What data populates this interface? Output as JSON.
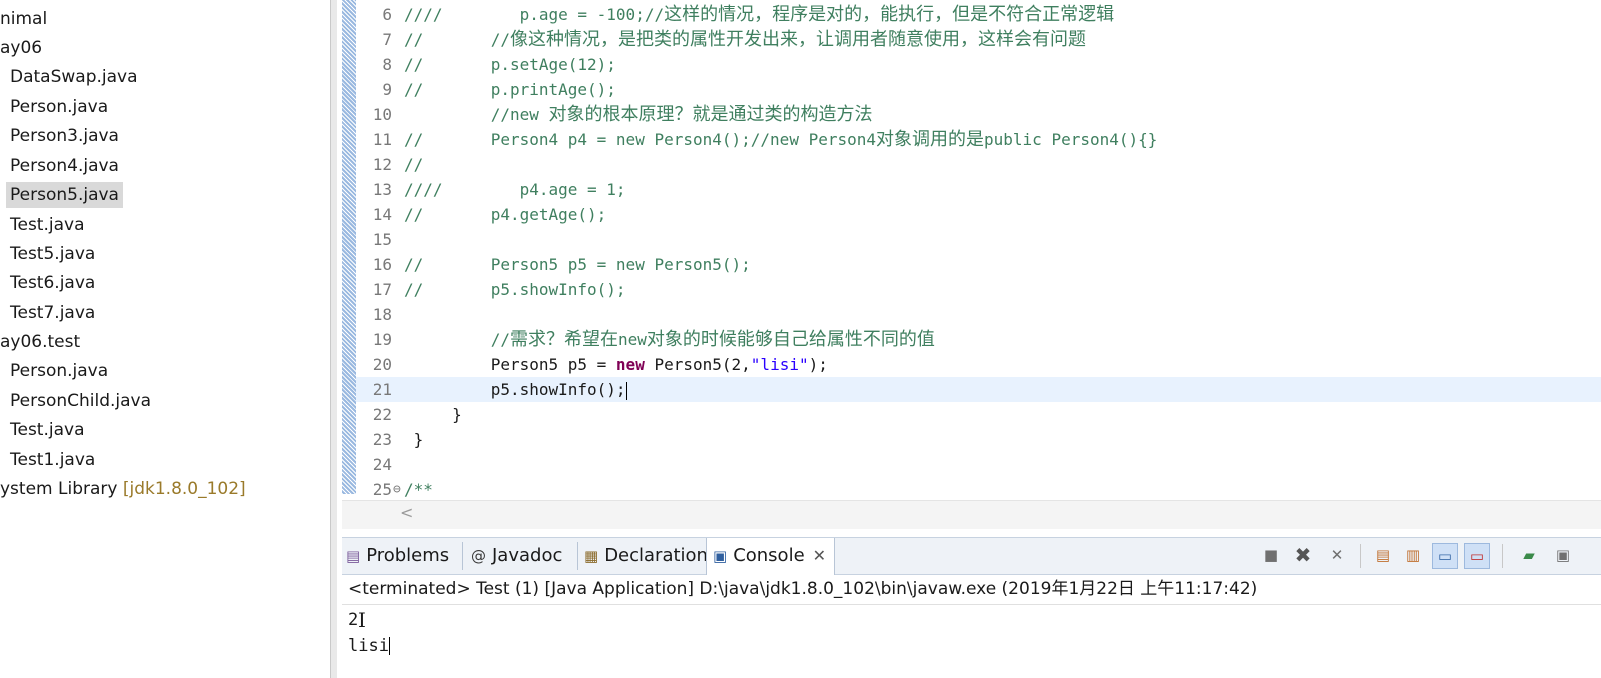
{
  "explorer": {
    "items": [
      {
        "label": "nimal"
      },
      {
        "label": "ay06"
      },
      {
        "label": "DataSwap.java"
      },
      {
        "label": "Person.java"
      },
      {
        "label": "Person3.java"
      },
      {
        "label": "Person4.java"
      },
      {
        "label": "Person5.java",
        "selected": true
      },
      {
        "label": "Test.java"
      },
      {
        "label": "Test5.java"
      },
      {
        "label": "Test6.java"
      },
      {
        "label": "Test7.java"
      },
      {
        "label": "ay06.test"
      },
      {
        "label": "Person.java"
      },
      {
        "label": "PersonChild.java"
      },
      {
        "label": "Test.java"
      },
      {
        "label": "Test1.java"
      },
      {
        "label": "ystem Library",
        "version": "[jdk1.8.0_102]"
      }
    ]
  },
  "editor": {
    "lines": [
      {
        "n": "6",
        "c1": "////        p.age = -100;//",
        "c2": "这样的情况，程序是对的，能执行，但是不符合正常逻辑"
      },
      {
        "n": "7",
        "c1": "//       //",
        "c2": "像这种情况，是把类的属性开发出来，让调用者随意使用，这样会有问题"
      },
      {
        "n": "8",
        "c1": "//       p.setAge(12);"
      },
      {
        "n": "9",
        "c1": "//       p.printAge();"
      },
      {
        "n": "10",
        "c1": "         //new ",
        "c2": "对象的根本原理？就是通过类的构造方法"
      },
      {
        "n": "11",
        "c1": "//       Person4 p4 = new Person4();//new Person4",
        "c2": "对象调用的是",
        "c3": "public Person4(){}"
      },
      {
        "n": "12",
        "c1": "//"
      },
      {
        "n": "13",
        "c1": "////        p4.age = 1;"
      },
      {
        "n": "14",
        "c1": "//       p4.getAge();"
      },
      {
        "n": "15",
        "c1": ""
      },
      {
        "n": "16",
        "c1": "//       Person5 p5 = new Person5();"
      },
      {
        "n": "17",
        "c1": "//       p5.showInfo();"
      },
      {
        "n": "18",
        "c1": ""
      },
      {
        "n": "19",
        "c1": "         //",
        "c2": "需求？希望在",
        "c3": "new",
        "c4": "对象的时候能够自己给属性不同的值"
      },
      {
        "n": "20",
        "p1": "         Person5 p5 = ",
        "kw": "new",
        "p2": " Person5(2,",
        "str": "\"lisi\"",
        "p3": ");"
      },
      {
        "n": "21",
        "p1": "         p5.showInfo();"
      },
      {
        "n": "22",
        "p1": "     }"
      },
      {
        "n": "23",
        "p1": " }"
      },
      {
        "n": "24",
        "p1": ""
      },
      {
        "n": "25",
        "c1": "/**"
      }
    ],
    "scroll_left_arrow": "<"
  },
  "views": {
    "tabs": [
      {
        "label": "Problems",
        "icon": "problems-icon"
      },
      {
        "label": "Javadoc",
        "icon": "at-icon"
      },
      {
        "label": "Declaration",
        "icon": "declaration-icon"
      },
      {
        "label": "Console",
        "icon": "console-icon",
        "active": true
      }
    ],
    "toolbar_icons": [
      "terminate-icon",
      "remove-launch-icon",
      "remove-all-terminated-icon",
      "clear-console-icon",
      "scroll-lock-icon",
      "word-wrap-icon",
      "show-console-on-output-icon",
      "show-console-on-error-icon",
      "pin-console-icon",
      "open-console-icon"
    ]
  },
  "console": {
    "header": "<terminated> Test (1) [Java Application] D:\\java\\jdk1.8.0_102\\bin\\javaw.exe (2019年1月22日 上午11:17:42)",
    "output": [
      "2",
      "lisi"
    ]
  }
}
